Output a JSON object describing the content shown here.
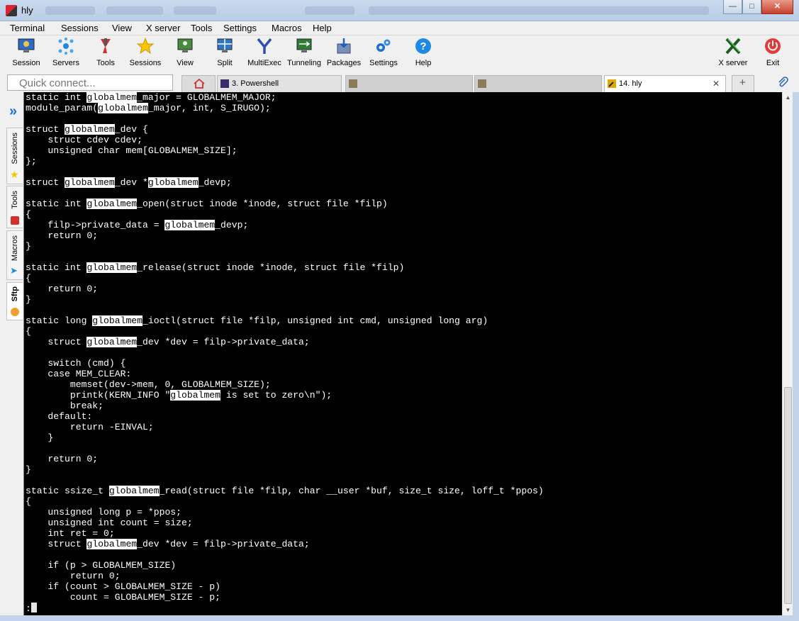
{
  "window": {
    "title": "hly"
  },
  "menu": [
    "Terminal",
    "Sessions",
    "View",
    "X server",
    "Tools",
    "Settings",
    "Macros",
    "Help"
  ],
  "toolbar": {
    "session": "Session",
    "servers": "Servers",
    "tools": "Tools",
    "sessions": "Sessions",
    "view": "View",
    "split": "Split",
    "multiexec": "MultiExec",
    "tunneling": "Tunneling",
    "packages": "Packages",
    "settings": "Settings",
    "help": "Help",
    "xserver": "X server",
    "exit": "Exit"
  },
  "quick_connect": {
    "placeholder": "Quick connect..."
  },
  "tabs": {
    "powershell": "3. Powershell",
    "active": "14. hly"
  },
  "sidetabs": {
    "sessions": "Sessions",
    "tools": "Tools",
    "macros": "Macros",
    "sftp": "Sftp"
  },
  "terminal": {
    "lines": [
      "static int [[globalmem]]_major = GLOBALMEM_MAJOR;",
      "module_param([[globalmem]]_major, int, S_IRUGO);",
      "",
      "struct [[globalmem]]_dev {",
      "    struct cdev cdev;",
      "    unsigned char mem[GLOBALMEM_SIZE];",
      "};",
      "",
      "struct [[globalmem]]_dev *[[globalmem]]_devp;",
      "",
      "static int [[globalmem]]_open(struct inode *inode, struct file *filp)",
      "{",
      "    filp->private_data = [[globalmem]]_devp;",
      "    return 0;",
      "}",
      "",
      "static int [[globalmem]]_release(struct inode *inode, struct file *filp)",
      "{",
      "    return 0;",
      "}",
      "",
      "static long [[globalmem]]_ioctl(struct file *filp, unsigned int cmd, unsigned long arg)",
      "{",
      "    struct [[globalmem]]_dev *dev = filp->private_data;",
      "",
      "    switch (cmd) {",
      "    case MEM_CLEAR:",
      "        memset(dev->mem, 0, GLOBALMEM_SIZE);",
      "        printk(KERN_INFO \"[[globalmem]] is set to zero\\n\");",
      "        break;",
      "    default:",
      "        return -EINVAL;",
      "    }",
      "",
      "    return 0;",
      "}",
      "",
      "static ssize_t [[globalmem]]_read(struct file *filp, char __user *buf, size_t size, loff_t *ppos)",
      "{",
      "    unsigned long p = *ppos;",
      "    unsigned int count = size;",
      "    int ret = 0;",
      "    struct [[globalmem]]_dev *dev = filp->private_data;",
      "",
      "    if (p > GLOBALMEM_SIZE)",
      "        return 0;",
      "    if (count > GLOBALMEM_SIZE - p)",
      "        count = GLOBALMEM_SIZE - p;"
    ],
    "prompt": ":"
  }
}
